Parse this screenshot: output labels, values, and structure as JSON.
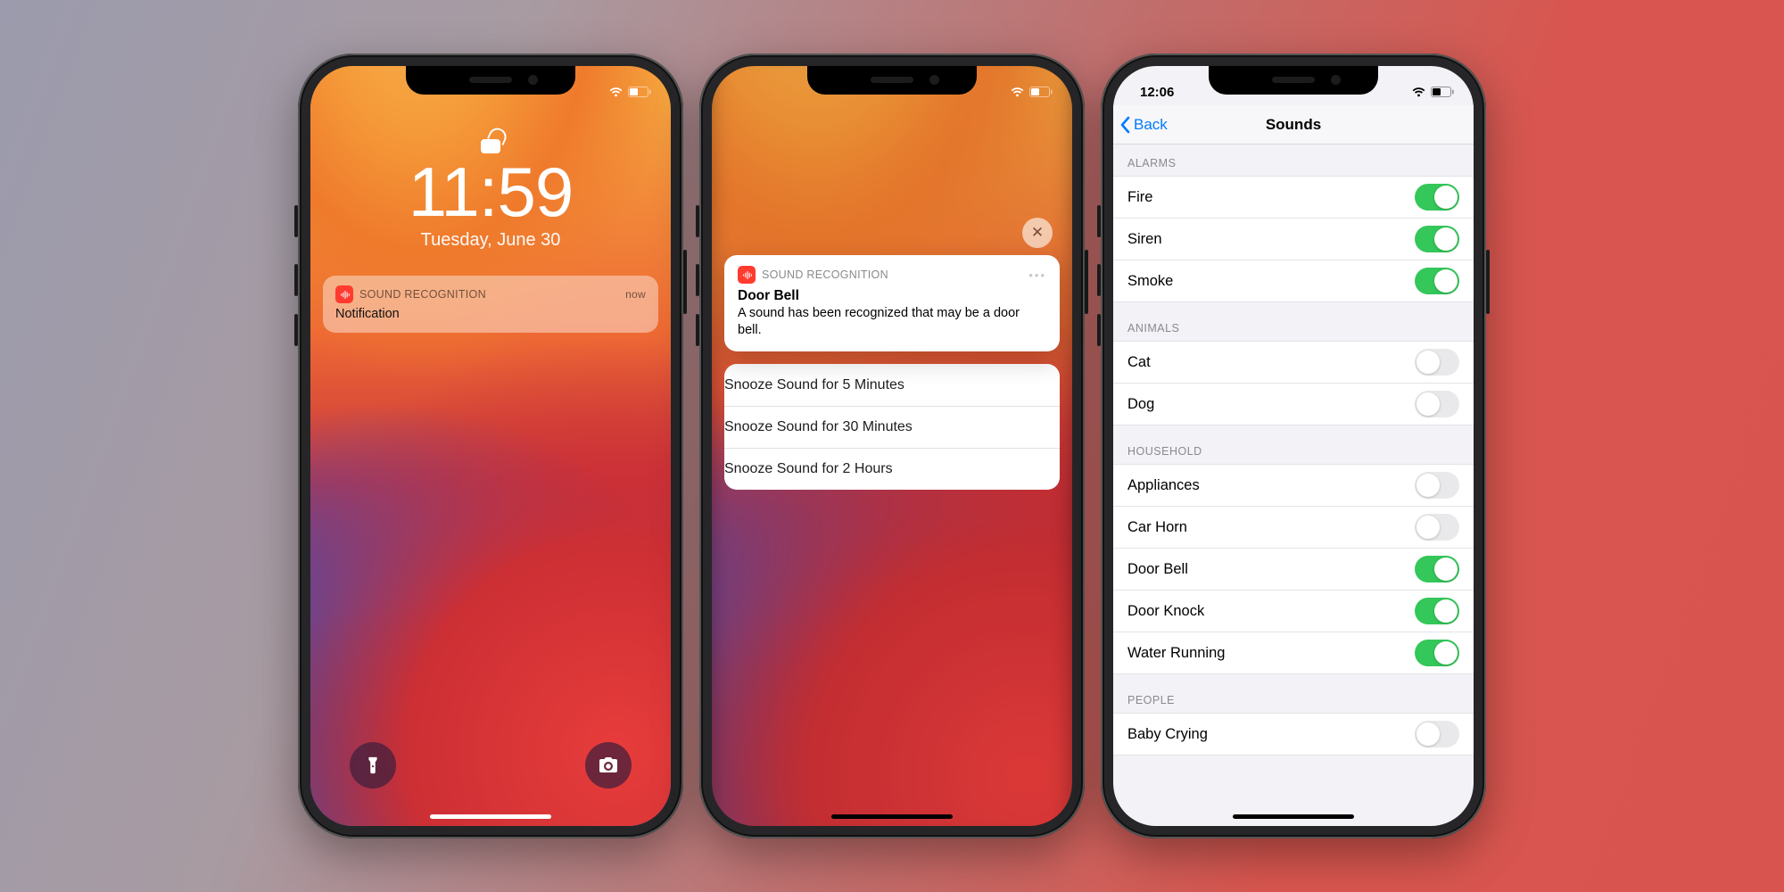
{
  "phone1": {
    "time": "11:59",
    "date": "Tuesday, June 30",
    "notification": {
      "app": "SOUND RECOGNITION",
      "message": "Notification",
      "timestamp": "now"
    },
    "buttons": {
      "flashlight": "flashlight-icon",
      "camera": "camera-icon"
    }
  },
  "phone2": {
    "card": {
      "app": "SOUND RECOGNITION",
      "title": "Door Bell",
      "body": "A sound has been recognized that may be a door bell."
    },
    "actions": [
      "Snooze Sound for 5 Minutes",
      "Snooze Sound for 30 Minutes",
      "Snooze Sound for 2 Hours"
    ],
    "close": "✕"
  },
  "phone3": {
    "statusTime": "12:06",
    "nav": {
      "back": "Back",
      "title": "Sounds"
    },
    "sections": [
      {
        "header": "ALARMS",
        "rows": [
          {
            "label": "Fire",
            "on": true
          },
          {
            "label": "Siren",
            "on": true
          },
          {
            "label": "Smoke",
            "on": true
          }
        ]
      },
      {
        "header": "ANIMALS",
        "rows": [
          {
            "label": "Cat",
            "on": false
          },
          {
            "label": "Dog",
            "on": false
          }
        ]
      },
      {
        "header": "HOUSEHOLD",
        "rows": [
          {
            "label": "Appliances",
            "on": false
          },
          {
            "label": "Car Horn",
            "on": false
          },
          {
            "label": "Door Bell",
            "on": true
          },
          {
            "label": "Door Knock",
            "on": true
          },
          {
            "label": "Water Running",
            "on": true
          }
        ]
      },
      {
        "header": "PEOPLE",
        "rows": [
          {
            "label": "Baby Crying",
            "on": false
          }
        ]
      }
    ]
  }
}
